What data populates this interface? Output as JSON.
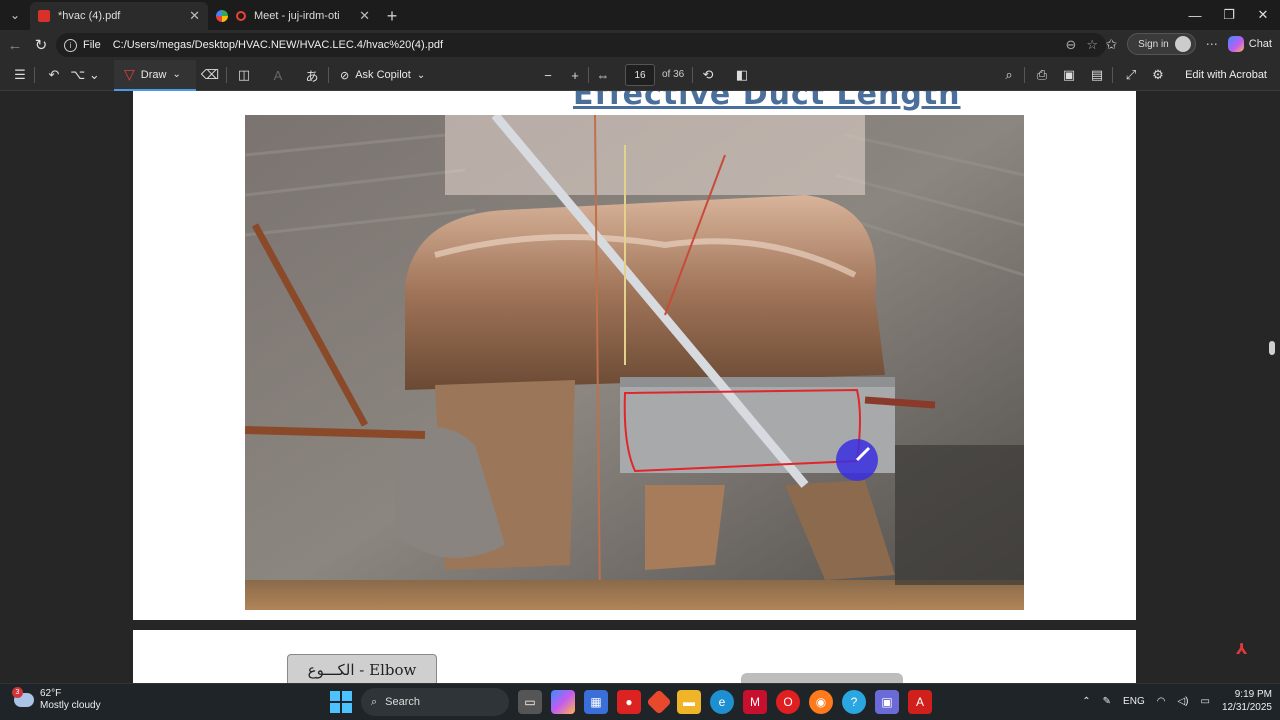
{
  "browser": {
    "tabs": [
      {
        "title": "*hvac (4).pdf",
        "active": true
      },
      {
        "title": "Meet - juj-irdm-oti",
        "active": false
      }
    ],
    "new_tab": "+",
    "window_controls": {
      "minimize": "—",
      "restore": "❐",
      "close": "✕"
    }
  },
  "address_bar": {
    "scheme": "File",
    "url": "C:/Users/megas/Desktop/HVAC.NEW/HVAC.LEC.4/hvac%20(4).pdf",
    "sign_in": "Sign in",
    "chat": "Chat"
  },
  "pdf_toolbar": {
    "draw_label": "Draw",
    "ask_copilot": "Ask Copilot",
    "page_current": "16",
    "page_total": "of 36",
    "edit_acrobat": "Edit with Acrobat",
    "accent": "#4a9ae8"
  },
  "document": {
    "page_title": "Effective Duct Length",
    "next_page_box": "الكـــوع - Elbow"
  },
  "taskbar": {
    "weather_temp": "62°F",
    "weather_desc": "Mostly cloudy",
    "weather_badge": "3",
    "search_placeholder": "Search",
    "language": "ENG",
    "time": "9:19 PM",
    "date": "12/31/2025"
  }
}
